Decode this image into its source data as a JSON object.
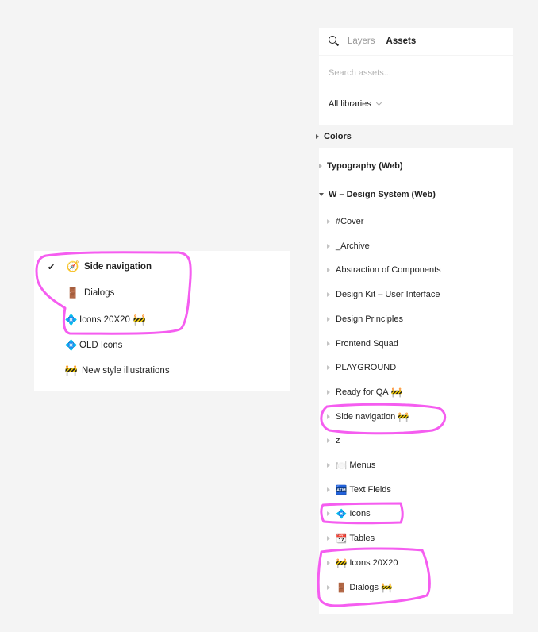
{
  "colors": {
    "background": "#f4f4f4",
    "panel": "#ffffff",
    "annotation": "#f55df0",
    "text": "#222222",
    "muted": "#9a9a9a"
  },
  "left_menu": {
    "items": [
      {
        "label": "Side navigation",
        "emoji": "🧭",
        "checked": true,
        "check_glyph": "✔"
      },
      {
        "label": "Dialogs",
        "emoji": "🚪",
        "checked": false
      },
      {
        "label": "Icons 20X20",
        "emoji": "💠",
        "suffix_emoji": "🚧",
        "checked": false
      },
      {
        "label": "OLD Icons",
        "emoji": "💠",
        "checked": false
      },
      {
        "label": "New style illustrations",
        "emoji": "🚧",
        "checked": false
      }
    ]
  },
  "assets_panel": {
    "search_icon": "search-icon",
    "tabs": [
      {
        "label": "Layers",
        "active": false
      },
      {
        "label": "Assets",
        "active": true
      }
    ],
    "search": {
      "placeholder": "Search assets...",
      "value": ""
    },
    "library_filter": {
      "selected": "All libraries"
    },
    "sections": [
      {
        "label": "Colors",
        "expanded": false
      },
      {
        "label": "Typography (Web)",
        "expanded": false
      },
      {
        "label": "W – Design System (Web)",
        "expanded": true
      }
    ],
    "pages": [
      {
        "label": "#Cover"
      },
      {
        "label": "_Archive"
      },
      {
        "label": "Abstraction of Components"
      },
      {
        "label": "Design Kit – User Interface"
      },
      {
        "label": "Design Principles"
      },
      {
        "label": "Frontend Squad"
      },
      {
        "label": "PLAYGROUND"
      },
      {
        "label": "Ready for QA",
        "suffix_emoji": "🚧"
      },
      {
        "label": "Side navigation",
        "suffix_emoji": "🚧"
      },
      {
        "label": "z"
      },
      {
        "label": "Menus",
        "emoji": "🍽️"
      },
      {
        "label": "Text Fields",
        "emoji": "🏧"
      },
      {
        "label": "Icons",
        "emoji": "💠"
      },
      {
        "label": "Tables",
        "emoji": "📆"
      },
      {
        "label": "Icons 20X20",
        "emoji": "🚧"
      },
      {
        "label": "Dialogs",
        "emoji": "🚪",
        "suffix_emoji": "🚧"
      }
    ]
  }
}
